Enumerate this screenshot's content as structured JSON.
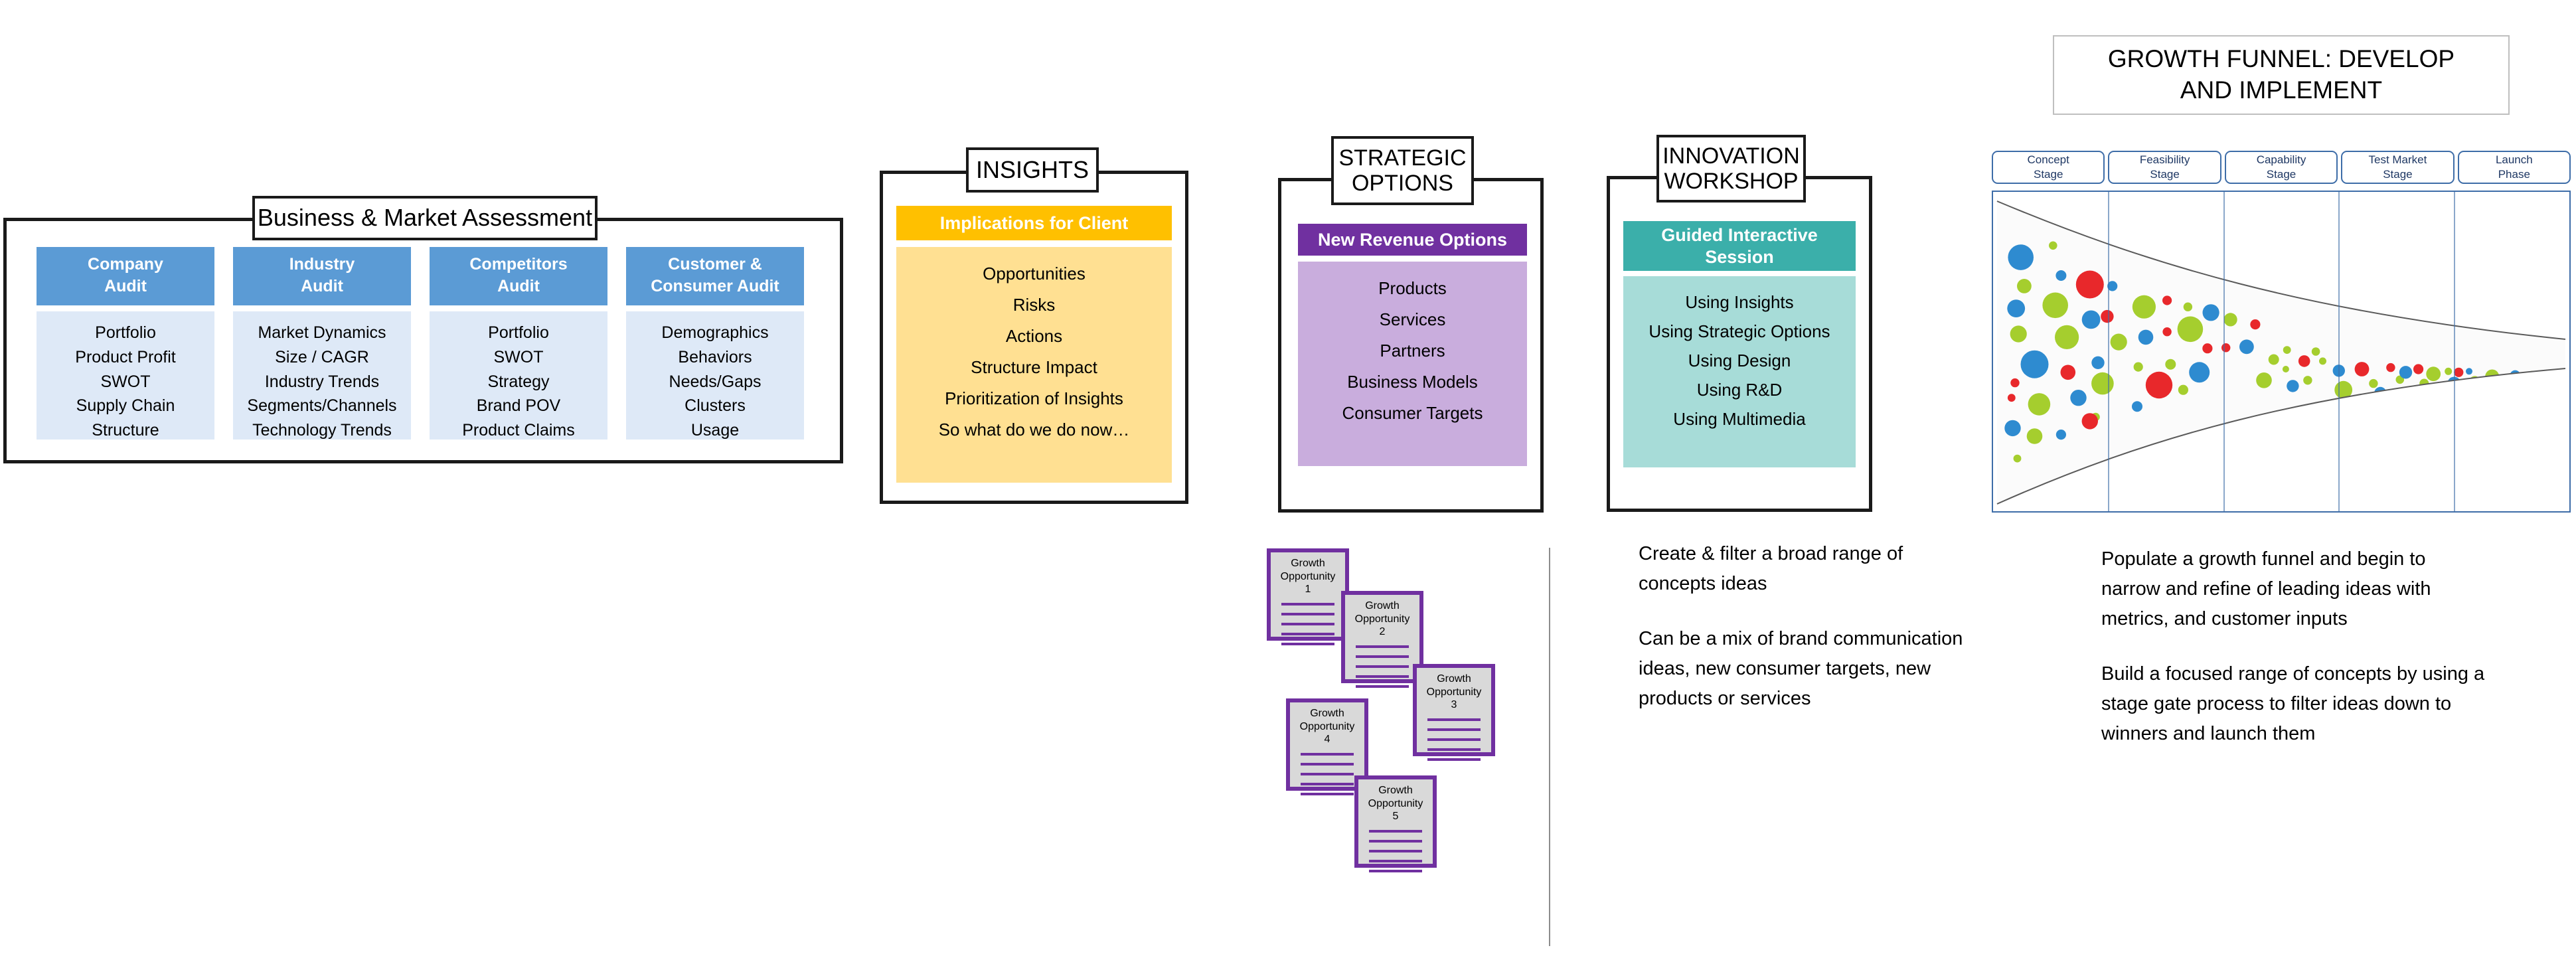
{
  "sections": {
    "bma": {
      "tab_label": "Business & Market Assessment",
      "columns": [
        {
          "head": "Company\nAudit",
          "head_l1": "Company",
          "head_l2": "Audit",
          "items": [
            "Portfolio",
            "Product Profit",
            "SWOT",
            "Supply Chain",
            "Structure"
          ]
        },
        {
          "head_l1": "Industry",
          "head_l2": "Audit",
          "items": [
            "Market Dynamics",
            "Size / CAGR",
            "Industry Trends",
            "Segments/Channels",
            "Technology Trends"
          ]
        },
        {
          "head_l1": "Competitors",
          "head_l2": "Audit",
          "items": [
            "Portfolio",
            "SWOT",
            "Strategy",
            "Brand POV",
            "Product Claims"
          ]
        },
        {
          "head_l1": "Customer &",
          "head_l2": "Consumer Audit",
          "items": [
            "Demographics",
            "Behaviors",
            "Needs/Gaps",
            "Clusters",
            "Usage"
          ]
        }
      ]
    },
    "insights": {
      "tab_label": "INSIGHTS",
      "header": "Implications for Client",
      "header_color": "#FFC000",
      "body_color": "#FFE092",
      "items": [
        "Opportunities",
        "Risks",
        "Actions",
        "Structure Impact",
        "Prioritization of Insights",
        "So what do we do now…"
      ]
    },
    "strategic_options": {
      "tab_l1": "STRATEGIC",
      "tab_l2": "OPTIONS",
      "header": "New Revenue Options",
      "header_color": "#7030A0",
      "body_color": "#C9ADDD",
      "items": [
        "Products",
        "Services",
        "Partners",
        "Business Models",
        "Consumer Targets"
      ]
    },
    "innovation_workshop": {
      "tab_l1": "INNOVATION",
      "tab_l2": "WORKSHOP",
      "header_l1": "Guided Interactive",
      "header_l2": "Session",
      "header_color": "#3BAFAA",
      "body_color": "#A7DCD8",
      "items": [
        "Using Insights",
        "Using Strategic Options",
        "Using Design",
        "Using R&D",
        "Using Multimedia"
      ]
    }
  },
  "growth_opportunity_cards": [
    {
      "title_l1": "Growth",
      "title_l2": "Opportunity",
      "number": "1"
    },
    {
      "title_l1": "Growth",
      "title_l2": "Opportunity",
      "number": "2"
    },
    {
      "title_l1": "Growth",
      "title_l2": "Opportunity",
      "number": "3"
    },
    {
      "title_l1": "Growth",
      "title_l2": "Opportunity",
      "number": "4"
    },
    {
      "title_l1": "Growth",
      "title_l2": "Opportunity",
      "number": "5"
    }
  ],
  "copy_middle": {
    "para1": "Create & filter a broad range of concepts ideas",
    "para2": "Can be a mix of brand communication ideas, new consumer targets, new products or services"
  },
  "copy_right": {
    "para1": "Populate a growth funnel and begin to narrow and refine of leading ideas with metrics, and customer inputs",
    "para2": "Build a focused range of concepts by using a stage gate process to filter ideas down to winners and launch them"
  },
  "growth_funnel": {
    "title_l1": "GROWTH FUNNEL: DEVELOP",
    "title_l2": "AND IMPLEMENT",
    "stages": [
      {
        "l1": "Concept",
        "l2": "Stage"
      },
      {
        "l1": "Feasibility",
        "l2": "Stage"
      },
      {
        "l1": "Capability",
        "l2": "Stage"
      },
      {
        "l1": "Test Market",
        "l2": "Stage"
      },
      {
        "l1": "Launch",
        "l2": "Phase"
      }
    ]
  },
  "chart_data": {
    "type": "scatter",
    "title": "GROWTH FUNNEL: DEVELOP AND IMPLEMENT",
    "xlabel": "",
    "ylabel": "",
    "categories": [
      "Concept Stage",
      "Feasibility Stage",
      "Capability Stage",
      "Test Market Stage",
      "Launch Phase"
    ],
    "legend": [
      "blue",
      "green",
      "red"
    ],
    "colors": {
      "blue": "#2E8BD0",
      "green": "#A5CE2E",
      "red": "#E8282B"
    },
    "grid": true,
    "note": "Bubble cloud inside a narrowing funnel; bubble count and size decrease left to right as ideas are filtered",
    "points": [
      {
        "x": 0.048,
        "y": 0.205,
        "r": 0.046,
        "c": "blue"
      },
      {
        "x": 0.104,
        "y": 0.168,
        "r": 0.015,
        "c": "green"
      },
      {
        "x": 0.054,
        "y": 0.295,
        "r": 0.026,
        "c": "green"
      },
      {
        "x": 0.118,
        "y": 0.262,
        "r": 0.019,
        "c": "blue"
      },
      {
        "x": 0.168,
        "y": 0.29,
        "r": 0.05,
        "c": "red"
      },
      {
        "x": 0.207,
        "y": 0.295,
        "r": 0.018,
        "c": "blue"
      },
      {
        "x": 0.04,
        "y": 0.365,
        "r": 0.032,
        "c": "blue"
      },
      {
        "x": 0.108,
        "y": 0.355,
        "r": 0.046,
        "c": "green"
      },
      {
        "x": 0.17,
        "y": 0.4,
        "r": 0.033,
        "c": "blue"
      },
      {
        "x": 0.198,
        "y": 0.39,
        "r": 0.023,
        "c": "red"
      },
      {
        "x": 0.262,
        "y": 0.36,
        "r": 0.042,
        "c": "green"
      },
      {
        "x": 0.302,
        "y": 0.34,
        "r": 0.017,
        "c": "red"
      },
      {
        "x": 0.338,
        "y": 0.36,
        "r": 0.016,
        "c": "green"
      },
      {
        "x": 0.378,
        "y": 0.378,
        "r": 0.03,
        "c": "blue"
      },
      {
        "x": 0.044,
        "y": 0.445,
        "r": 0.03,
        "c": "green"
      },
      {
        "x": 0.128,
        "y": 0.455,
        "r": 0.043,
        "c": "green"
      },
      {
        "x": 0.218,
        "y": 0.47,
        "r": 0.03,
        "c": "green"
      },
      {
        "x": 0.265,
        "y": 0.455,
        "r": 0.027,
        "c": "blue"
      },
      {
        "x": 0.302,
        "y": 0.438,
        "r": 0.016,
        "c": "red"
      },
      {
        "x": 0.342,
        "y": 0.43,
        "r": 0.046,
        "c": "green"
      },
      {
        "x": 0.412,
        "y": 0.4,
        "r": 0.024,
        "c": "green"
      },
      {
        "x": 0.455,
        "y": 0.415,
        "r": 0.018,
        "c": "red"
      },
      {
        "x": 0.072,
        "y": 0.54,
        "r": 0.05,
        "c": "blue"
      },
      {
        "x": 0.182,
        "y": 0.535,
        "r": 0.023,
        "c": "blue"
      },
      {
        "x": 0.13,
        "y": 0.565,
        "r": 0.027,
        "c": "red"
      },
      {
        "x": 0.252,
        "y": 0.548,
        "r": 0.017,
        "c": "green"
      },
      {
        "x": 0.308,
        "y": 0.54,
        "r": 0.019,
        "c": "green"
      },
      {
        "x": 0.372,
        "y": 0.49,
        "r": 0.018,
        "c": "red"
      },
      {
        "x": 0.404,
        "y": 0.488,
        "r": 0.016,
        "c": "red"
      },
      {
        "x": 0.44,
        "y": 0.485,
        "r": 0.026,
        "c": "blue"
      },
      {
        "x": 0.038,
        "y": 0.598,
        "r": 0.016,
        "c": "red"
      },
      {
        "x": 0.19,
        "y": 0.6,
        "r": 0.04,
        "c": "green"
      },
      {
        "x": 0.288,
        "y": 0.605,
        "r": 0.048,
        "c": "red"
      },
      {
        "x": 0.358,
        "y": 0.565,
        "r": 0.037,
        "c": "blue"
      },
      {
        "x": 0.33,
        "y": 0.62,
        "r": 0.018,
        "c": "green"
      },
      {
        "x": 0.032,
        "y": 0.645,
        "r": 0.014,
        "c": "red"
      },
      {
        "x": 0.08,
        "y": 0.665,
        "r": 0.04,
        "c": "green"
      },
      {
        "x": 0.148,
        "y": 0.645,
        "r": 0.029,
        "c": "blue"
      },
      {
        "x": 0.178,
        "y": 0.705,
        "r": 0.015,
        "c": "green"
      },
      {
        "x": 0.25,
        "y": 0.672,
        "r": 0.019,
        "c": "blue"
      },
      {
        "x": 0.168,
        "y": 0.718,
        "r": 0.029,
        "c": "red"
      },
      {
        "x": 0.034,
        "y": 0.74,
        "r": 0.029,
        "c": "blue"
      },
      {
        "x": 0.072,
        "y": 0.765,
        "r": 0.028,
        "c": "green"
      },
      {
        "x": 0.118,
        "y": 0.76,
        "r": 0.018,
        "c": "blue"
      },
      {
        "x": 0.042,
        "y": 0.835,
        "r": 0.014,
        "c": "green"
      },
      {
        "x": 0.487,
        "y": 0.525,
        "r": 0.019,
        "c": "green"
      },
      {
        "x": 0.47,
        "y": 0.59,
        "r": 0.028,
        "c": "green"
      },
      {
        "x": 0.508,
        "y": 0.555,
        "r": 0.012,
        "c": "green"
      },
      {
        "x": 0.54,
        "y": 0.53,
        "r": 0.021,
        "c": "red"
      },
      {
        "x": 0.56,
        "y": 0.5,
        "r": 0.015,
        "c": "green"
      },
      {
        "x": 0.572,
        "y": 0.53,
        "r": 0.013,
        "c": "green"
      },
      {
        "x": 0.51,
        "y": 0.495,
        "r": 0.014,
        "c": "green"
      },
      {
        "x": 0.52,
        "y": 0.608,
        "r": 0.022,
        "c": "blue"
      },
      {
        "x": 0.546,
        "y": 0.59,
        "r": 0.016,
        "c": "green"
      },
      {
        "x": 0.6,
        "y": 0.56,
        "r": 0.022,
        "c": "blue"
      },
      {
        "x": 0.608,
        "y": 0.62,
        "r": 0.032,
        "c": "green"
      },
      {
        "x": 0.64,
        "y": 0.555,
        "r": 0.026,
        "c": "red"
      },
      {
        "x": 0.66,
        "y": 0.6,
        "r": 0.016,
        "c": "green"
      },
      {
        "x": 0.672,
        "y": 0.63,
        "r": 0.022,
        "c": "blue"
      },
      {
        "x": 0.69,
        "y": 0.55,
        "r": 0.016,
        "c": "red"
      },
      {
        "x": 0.706,
        "y": 0.588,
        "r": 0.015,
        "c": "green"
      },
      {
        "x": 0.716,
        "y": 0.565,
        "r": 0.023,
        "c": "blue"
      },
      {
        "x": 0.738,
        "y": 0.555,
        "r": 0.018,
        "c": "red"
      },
      {
        "x": 0.748,
        "y": 0.6,
        "r": 0.017,
        "c": "green"
      },
      {
        "x": 0.764,
        "y": 0.57,
        "r": 0.026,
        "c": "green"
      },
      {
        "x": 0.79,
        "y": 0.562,
        "r": 0.013,
        "c": "green"
      },
      {
        "x": 0.808,
        "y": 0.565,
        "r": 0.017,
        "c": "red"
      },
      {
        "x": 0.826,
        "y": 0.562,
        "r": 0.012,
        "c": "blue"
      },
      {
        "x": 0.8,
        "y": 0.6,
        "r": 0.024,
        "c": "blue"
      },
      {
        "x": 0.836,
        "y": 0.595,
        "r": 0.021,
        "c": "green"
      },
      {
        "x": 0.866,
        "y": 0.578,
        "r": 0.025,
        "c": "green"
      },
      {
        "x": 0.906,
        "y": 0.575,
        "r": 0.019,
        "c": "blue"
      },
      {
        "x": 0.936,
        "y": 0.578,
        "r": 0.02,
        "c": "green"
      },
      {
        "x": 0.964,
        "y": 0.576,
        "r": 0.015,
        "c": "red"
      },
      {
        "x": 0.986,
        "y": 0.578,
        "r": 0.014,
        "c": "blue"
      }
    ]
  }
}
